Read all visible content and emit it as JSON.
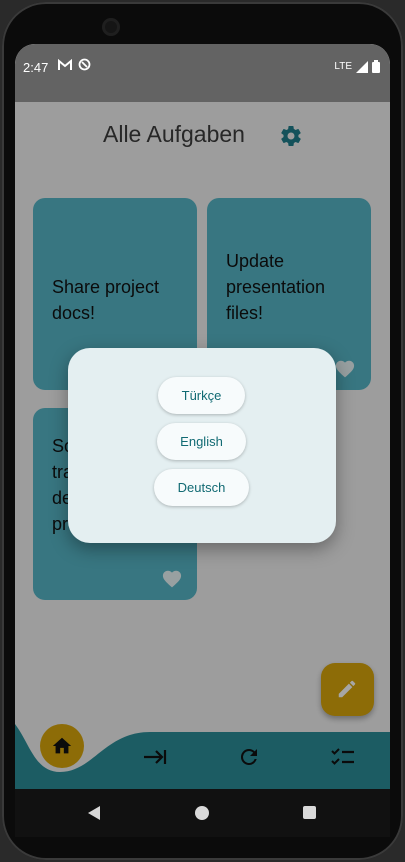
{
  "status": {
    "time": "2:47",
    "network": "LTE"
  },
  "app": {
    "title": "Alle Aufgaben"
  },
  "cards": [
    {
      "text": "Share project docs!"
    },
    {
      "text": "Update presentation files!"
    },
    {
      "text": "So\ntra\nde\npr"
    }
  ],
  "dialog": {
    "languages": [
      "Türkçe",
      "English",
      "Deutsch"
    ]
  },
  "icons": {
    "settings": "gear-icon",
    "fab": "pencil-icon",
    "home": "home-icon",
    "login": "arrow-right-bar-icon",
    "refresh": "refresh-icon",
    "checklist": "checklist-icon",
    "heart": "heart-icon"
  },
  "colors": {
    "accent": "#1f7f8c",
    "card": "#56b6c6",
    "fab": "#d9a60c",
    "nav": "#2b8e99"
  }
}
